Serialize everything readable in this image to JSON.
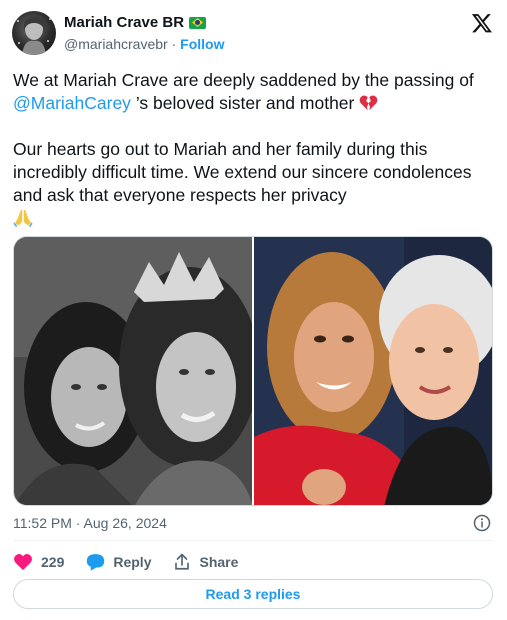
{
  "author": {
    "display_name": "Mariah Crave BR",
    "flag_icon": "brazil-flag-icon",
    "handle": "@mariahcravebr",
    "separator": "·",
    "follow_label": "Follow"
  },
  "brand_icon": "x-logo-icon",
  "tweet": {
    "line1_prefix": "We at Mariah Crave are deeply saddened by the passing of",
    "mention": "@MariahCarey",
    "line2_suffix": "’s beloved sister and mother",
    "paragraph2": "Our hearts go out to Mariah and her family during this incredibly difficult time. We extend our sincere condolences and ask that everyone respects her privacy",
    "emojis": [
      "broken-heart-icon",
      "folded-hands-icon"
    ]
  },
  "media": {
    "photos": [
      "black-and-white-photo",
      "color-photo"
    ]
  },
  "timestamp": "11:52 PM · Aug 26, 2024",
  "actions": {
    "like_count": "229",
    "reply_label": "Reply",
    "share_label": "Share"
  },
  "read_replies_label": "Read 3 replies",
  "colors": {
    "accent": "#1d9bf0",
    "like": "#f91880",
    "text": "#0f1419",
    "secondary": "#536471"
  }
}
